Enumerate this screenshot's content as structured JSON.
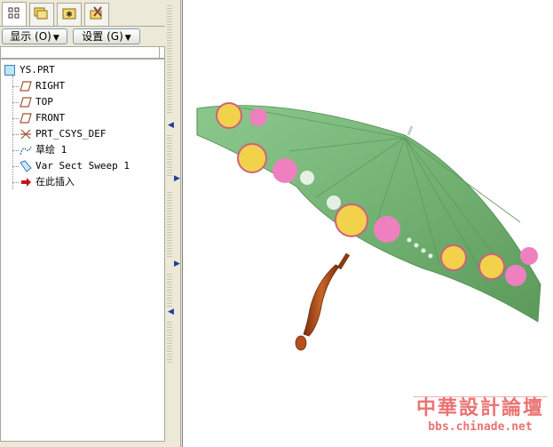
{
  "tabs": [
    {
      "icon": "model-tree-icon"
    },
    {
      "icon": "folder-layers-icon"
    },
    {
      "icon": "favorites-folder-icon"
    },
    {
      "icon": "tools-icon"
    }
  ],
  "toolbar": {
    "show_label": "显示 (O)",
    "settings_label": "设置 (G)"
  },
  "tree": {
    "root": {
      "label": "YS.PRT",
      "icon": "part-icon"
    },
    "items": [
      {
        "label": "RIGHT",
        "icon": "datum-plane-icon"
      },
      {
        "label": "TOP",
        "icon": "datum-plane-icon"
      },
      {
        "label": "FRONT",
        "icon": "datum-plane-icon"
      },
      {
        "label": "PRT_CSYS_DEF",
        "icon": "coordinate-system-icon"
      },
      {
        "label": "草绘 1",
        "icon": "sketch-icon"
      },
      {
        "label": "Var Sect Sweep 1",
        "icon": "sweep-icon"
      },
      {
        "label": "在此插入",
        "icon": "insert-here-arrow-icon"
      }
    ]
  },
  "viewport": {
    "model_description_colors": {
      "canopy": "#7ab87a",
      "handle": "#b5501e",
      "flower_yellow": "#f2d24a",
      "flower_pink": "#ee80c0"
    }
  },
  "watermark": {
    "title": "中華設計論壇",
    "url": "bbs.chinade.net"
  }
}
